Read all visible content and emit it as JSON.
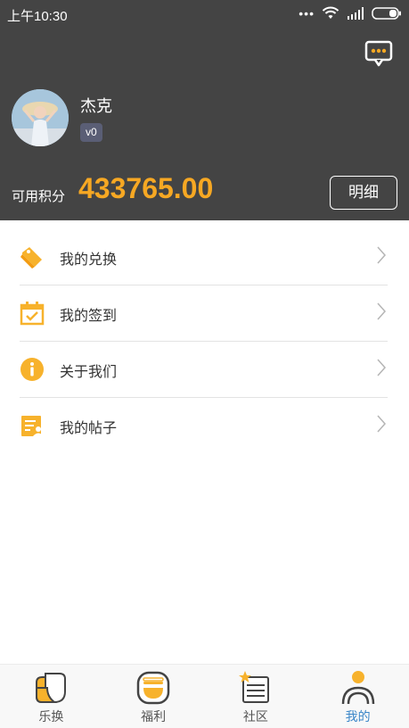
{
  "status_bar": {
    "time": "上午10:30",
    "dots": "•••"
  },
  "profile": {
    "username": "杰克",
    "level": "v0"
  },
  "points": {
    "label": "可用积分",
    "value": "433765.00",
    "detail_button": "明细"
  },
  "menu": [
    {
      "label": "我的兑换",
      "icon": "tag-icon"
    },
    {
      "label": "我的签到",
      "icon": "calendar-check-icon"
    },
    {
      "label": "关于我们",
      "icon": "info-icon"
    },
    {
      "label": "我的帖子",
      "icon": "posts-icon"
    }
  ],
  "tabs": [
    {
      "label": "乐换",
      "icon": "exchange-icon",
      "active": false
    },
    {
      "label": "福利",
      "icon": "welfare-icon",
      "active": false
    },
    {
      "label": "社区",
      "icon": "community-icon",
      "active": false
    },
    {
      "label": "我的",
      "icon": "profile-icon",
      "active": true
    }
  ],
  "colors": {
    "header_bg": "#444444",
    "accent": "#f7a823",
    "active_tab": "#3a86c8",
    "level_badge": "#5a5e75"
  }
}
